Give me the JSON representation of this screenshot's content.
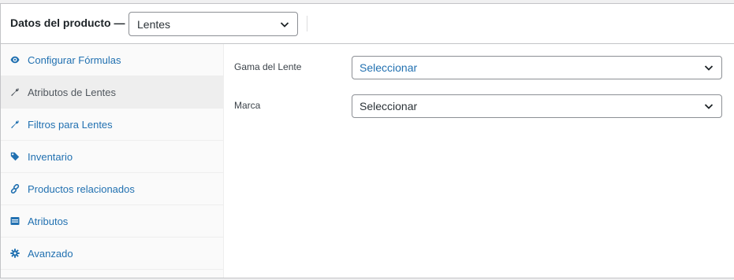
{
  "header": {
    "title": "Datos del producto —",
    "product_type": "Lentes"
  },
  "sidebar": {
    "items": [
      {
        "label": "Configurar Fórmulas",
        "icon": "eye-icon"
      },
      {
        "label": "Atributos de Lentes",
        "icon": "wrench-icon"
      },
      {
        "label": "Filtros para Lentes",
        "icon": "wrench-icon"
      },
      {
        "label": "Inventario",
        "icon": "tag-icon"
      },
      {
        "label": "Productos relacionados",
        "icon": "link-icon"
      },
      {
        "label": "Atributos",
        "icon": "table-icon"
      },
      {
        "label": "Avanzado",
        "icon": "gear-icon"
      }
    ],
    "active_index": 1
  },
  "fields": [
    {
      "label": "Gama del Lente",
      "value": "Seleccionar"
    },
    {
      "label": "Marca",
      "value": "Seleccionar"
    }
  ],
  "colors": {
    "link": "#2271b1",
    "active_tab_bg": "#eeeeee",
    "border": "#c3c4c7"
  }
}
